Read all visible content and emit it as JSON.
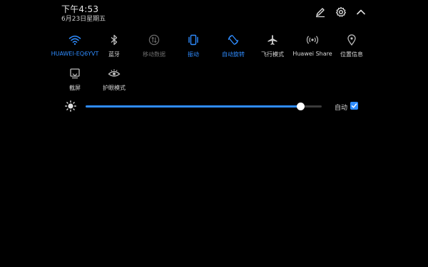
{
  "status": {
    "time": "下午4:53",
    "date": "6月23日星期五"
  },
  "header_icons": {
    "edit": "edit-pencil-icon",
    "settings": "gear-icon",
    "collapse": "chevron-up-icon"
  },
  "toggles": [
    {
      "label": "HUAWEI-EQ6YVT",
      "icon": "wifi-icon",
      "state": "active"
    },
    {
      "label": "蓝牙",
      "icon": "bluetooth-icon",
      "state": "off"
    },
    {
      "label": "移动数据",
      "icon": "mobile-data-icon",
      "state": "disabled"
    },
    {
      "label": "振动",
      "icon": "vibrate-icon",
      "state": "active"
    },
    {
      "label": "自动旋转",
      "icon": "auto-rotate-icon",
      "state": "active"
    },
    {
      "label": "飞行模式",
      "icon": "airplane-icon",
      "state": "off"
    },
    {
      "label": "Huawei Share",
      "icon": "huawei-share-icon",
      "state": "off"
    },
    {
      "label": "位置信息",
      "icon": "location-icon",
      "state": "off"
    },
    {
      "label": "截屏",
      "icon": "screenshot-icon",
      "state": "off"
    },
    {
      "label": "护眼模式",
      "icon": "eye-comfort-icon",
      "state": "off"
    }
  ],
  "brightness": {
    "icon": "brightness-sun-icon",
    "level_percent": 91,
    "auto_label": "自动",
    "auto_checked": true
  },
  "colors": {
    "accent": "#2f8cff",
    "background": "#000000",
    "text": "#d9d9d9",
    "disabled": "#6c6c6c"
  }
}
